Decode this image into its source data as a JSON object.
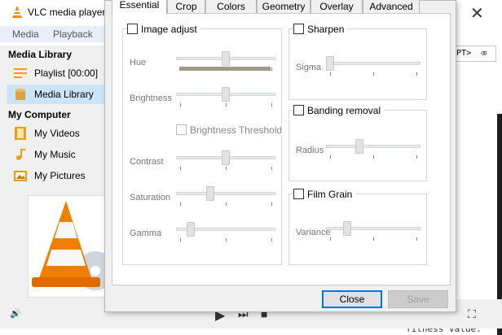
{
  "window": {
    "title": "VLC media player"
  },
  "menu": {
    "media": "Media",
    "playback": "Playback"
  },
  "right_pane": {
    "text": "RIPT>"
  },
  "sidebar": {
    "media_library_heading": "Media Library",
    "playlist": "Playlist [00:00]",
    "media_library": "Media Library",
    "my_computer_heading": "My Computer",
    "my_videos": "My Videos",
    "my_music": "My Music",
    "my_pictures": "My Pictures"
  },
  "tabs": [
    "Essential",
    "Crop",
    "Colors",
    "Geometry",
    "Overlay",
    "Advanced"
  ],
  "active_tab": "Essential",
  "image_adjust": {
    "label": "Image adjust",
    "checked": false,
    "hue_label": "Hue",
    "hue": 0.5,
    "brightness_label": "Brightness",
    "brightness": 0.5,
    "brightness_threshold": "Brightness Threshold",
    "contrast_label": "Contrast",
    "contrast": 0.5,
    "saturation_label": "Saturation",
    "saturation": 0.33,
    "gamma_label": "Gamma",
    "gamma": 0.12
  },
  "sharpen": {
    "label": "Sharpen",
    "checked": false,
    "sigma_label": "Sigma",
    "sigma": 0.0
  },
  "banding": {
    "label": "Banding removal",
    "checked": false,
    "radius_label": "Radius",
    "radius": 0.34
  },
  "film_grain": {
    "label": "Film Grain",
    "checked": false,
    "variance_label": "Variance",
    "variance": 0.2
  },
  "buttons": {
    "close": "Close",
    "save": "Save"
  },
  "terminal": {
    "bottom_text": "fitness value:"
  }
}
